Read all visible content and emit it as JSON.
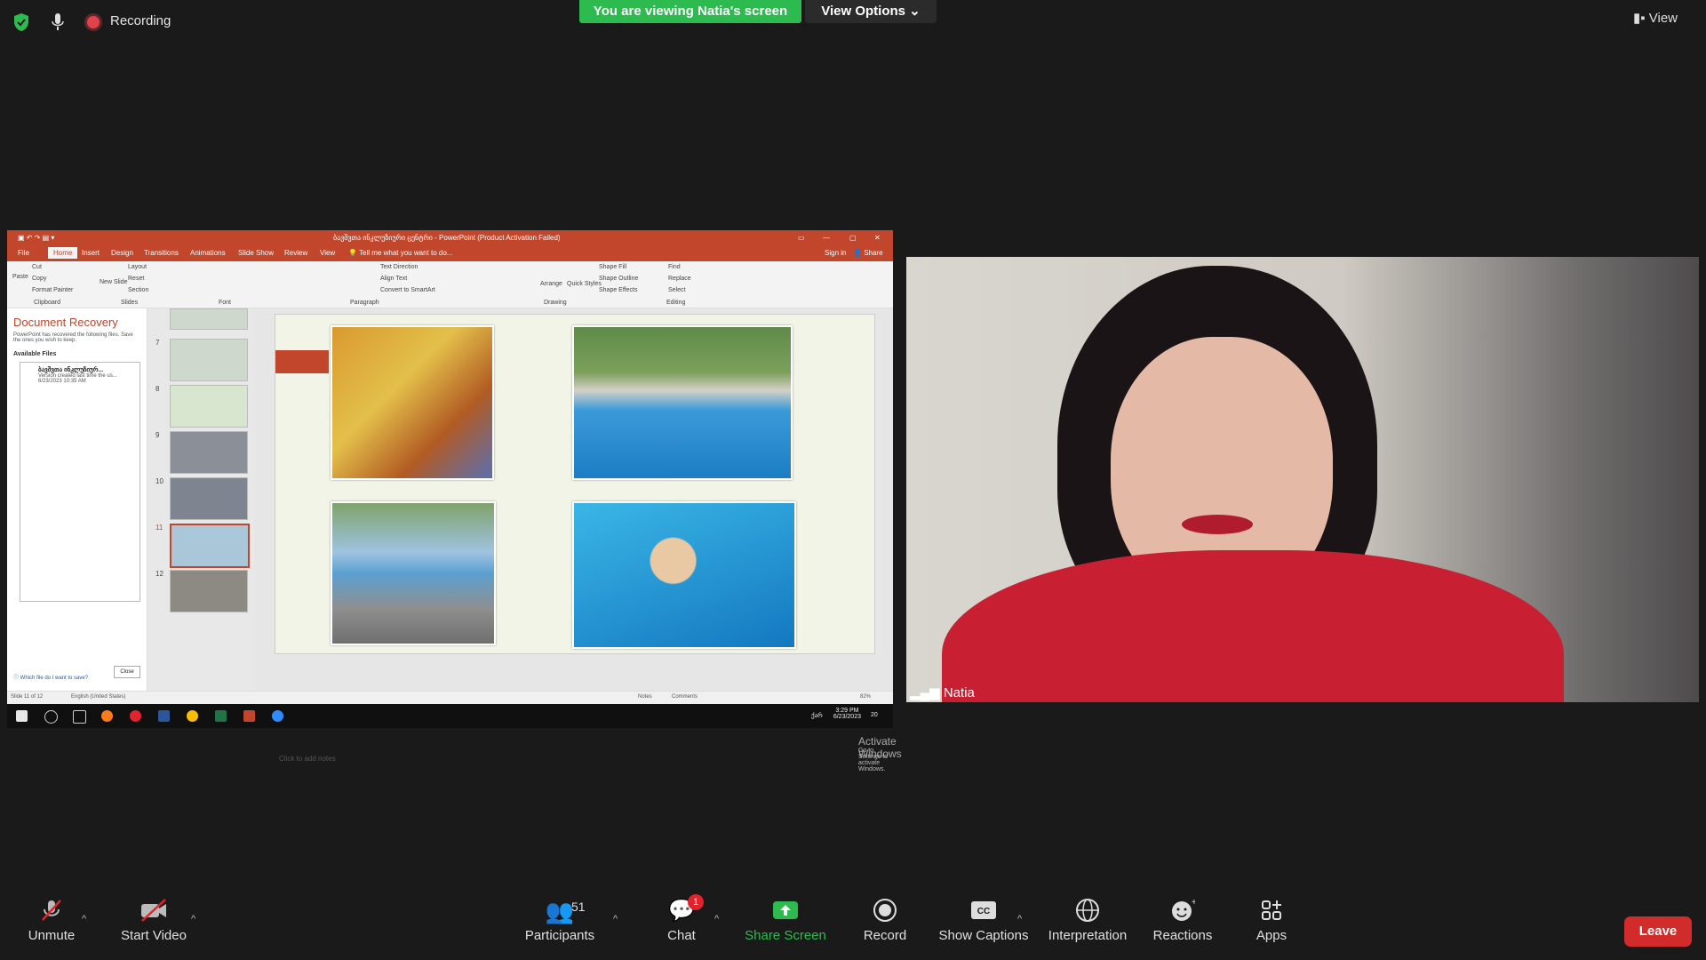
{
  "top": {
    "recording_label": "Recording",
    "viewing_banner": "You are viewing Natia's screen",
    "view_options": "View Options",
    "view_button": "View"
  },
  "powerpoint": {
    "title": "ბავშვთა ინკლუზიური ცენტრი - PowerPoint (Product Activation Failed)",
    "tabs": [
      "File",
      "Home",
      "Insert",
      "Design",
      "Transitions",
      "Animations",
      "Slide Show",
      "Review",
      "View"
    ],
    "tell_me": "Tell me what you want to do...",
    "sign_in": "Sign in",
    "share": "Share",
    "ribbon": {
      "paste": "Paste",
      "cut": "Cut",
      "copy": "Copy",
      "format_painter": "Format Painter",
      "clipboard": "Clipboard",
      "new_slide": "New Slide",
      "layout": "Layout",
      "reset": "Reset",
      "section": "Section",
      "slides": "Slides",
      "font": "Font",
      "paragraph": "Paragraph",
      "text_direction": "Text Direction",
      "align_text": "Align Text",
      "convert_smartart": "Convert to SmartArt",
      "arrange": "Arrange",
      "quick_styles": "Quick Styles",
      "shape_fill": "Shape Fill",
      "shape_outline": "Shape Outline",
      "shape_effects": "Shape Effects",
      "drawing": "Drawing",
      "find": "Find",
      "replace": "Replace",
      "select": "Select",
      "editing": "Editing"
    },
    "recovery": {
      "title": "Document Recovery",
      "desc": "PowerPoint has recovered the following files. Save the ones you wish to keep.",
      "available": "Available Files",
      "file_name": "ბავშვთა ინკლუზიურ...",
      "file_note": "Version created last time the us...",
      "file_date": "6/23/2023 10:35 AM",
      "question": "Which file do I want to save?",
      "close": "Close"
    },
    "thumb_numbers": [
      "7",
      "8",
      "9",
      "10",
      "11",
      "12"
    ],
    "notes_placeholder": "Click to add notes",
    "activate_title": "Activate Windows",
    "activate_sub": "Go to Settings to activate Windows.",
    "status_left": "Slide 11 of 12",
    "status_lang": "English (United States)",
    "status_notes": "Notes",
    "status_comments": "Comments",
    "zoom": "82%",
    "clock_time": "3:29 PM",
    "clock_date": "6/23/2023",
    "lang_indicator": "ქარ",
    "notif_count": "20"
  },
  "video": {
    "participant_name": "Natia"
  },
  "bottom": {
    "unmute": "Unmute",
    "start_video": "Start Video",
    "participants": "Participants",
    "participants_count": "51",
    "chat": "Chat",
    "chat_badge": "1",
    "share_screen": "Share Screen",
    "record": "Record",
    "show_captions": "Show Captions",
    "interpretation": "Interpretation",
    "reactions": "Reactions",
    "apps": "Apps",
    "leave": "Leave"
  },
  "colors": {
    "banner_green": "#2dbb4f",
    "powerpoint_accent": "#c1462b",
    "leave_red": "#d22b2b"
  }
}
